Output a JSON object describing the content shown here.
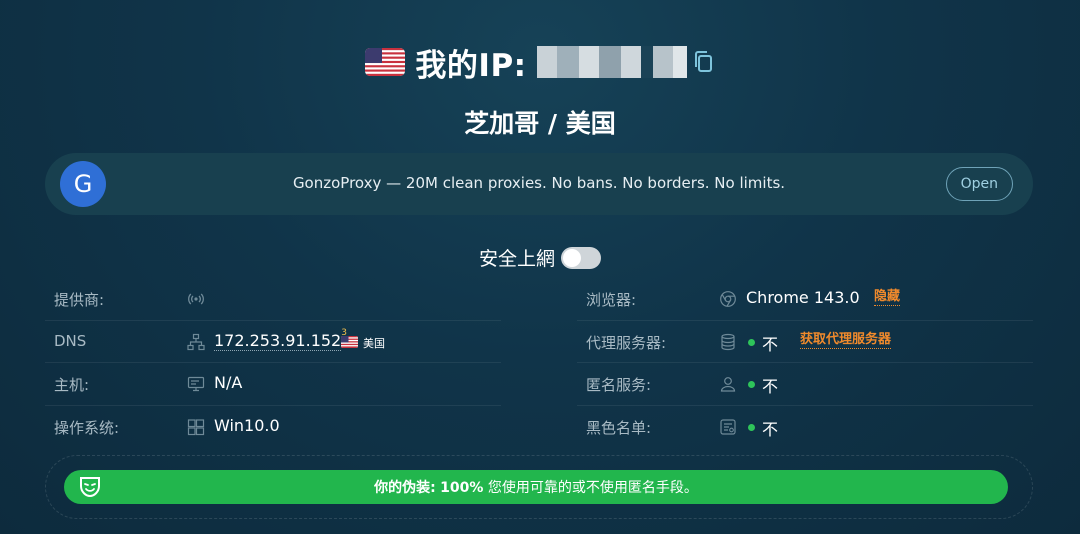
{
  "header": {
    "flag_icon": "us-flag-icon",
    "ip_label": "我的IP:",
    "copy_icon": "copy-icon",
    "location": "芝加哥 / 美国"
  },
  "promo": {
    "logo_letter": "G",
    "text": "GonzoProxy — 20M clean proxies. No bans. No borders. No limits.",
    "button_label": "Open"
  },
  "safe_browsing": {
    "label": "安全上網",
    "enabled": false
  },
  "left_rows": {
    "provider": {
      "label": "提供商:",
      "icon": "signal-icon",
      "value": ""
    },
    "dns": {
      "label": "DNS",
      "icon": "network-icon",
      "value": "172.253.91.152",
      "superscript": "3",
      "country": "美国"
    },
    "host": {
      "label": "主机:",
      "icon": "monitor-icon",
      "value": "N/A"
    },
    "os": {
      "label": "操作系统:",
      "icon": "windows-icon",
      "value": "Win10.0"
    }
  },
  "right_rows": {
    "browser": {
      "label": "浏览器:",
      "icon": "chrome-icon",
      "value": "Chrome 143.0",
      "link": "隐藏"
    },
    "proxy": {
      "label": "代理服务器:",
      "icon": "database-icon",
      "value": "不",
      "link": "获取代理服务器"
    },
    "anonymizer": {
      "label": "匿名服务:",
      "icon": "user-icon",
      "value": "不"
    },
    "blacklist": {
      "label": "黑色名单:",
      "icon": "list-icon",
      "value": "不"
    }
  },
  "disguise": {
    "icon": "mask-icon",
    "label": "你的伪装:",
    "percent": "100%",
    "message": "您使用可靠的或不使用匿名手段。"
  },
  "colors": {
    "background": "#103449",
    "success": "#22b64d",
    "link_orange": "#f08a2c",
    "status_dot": "#2ec45a",
    "promo_logo": "#2f6fd6"
  }
}
